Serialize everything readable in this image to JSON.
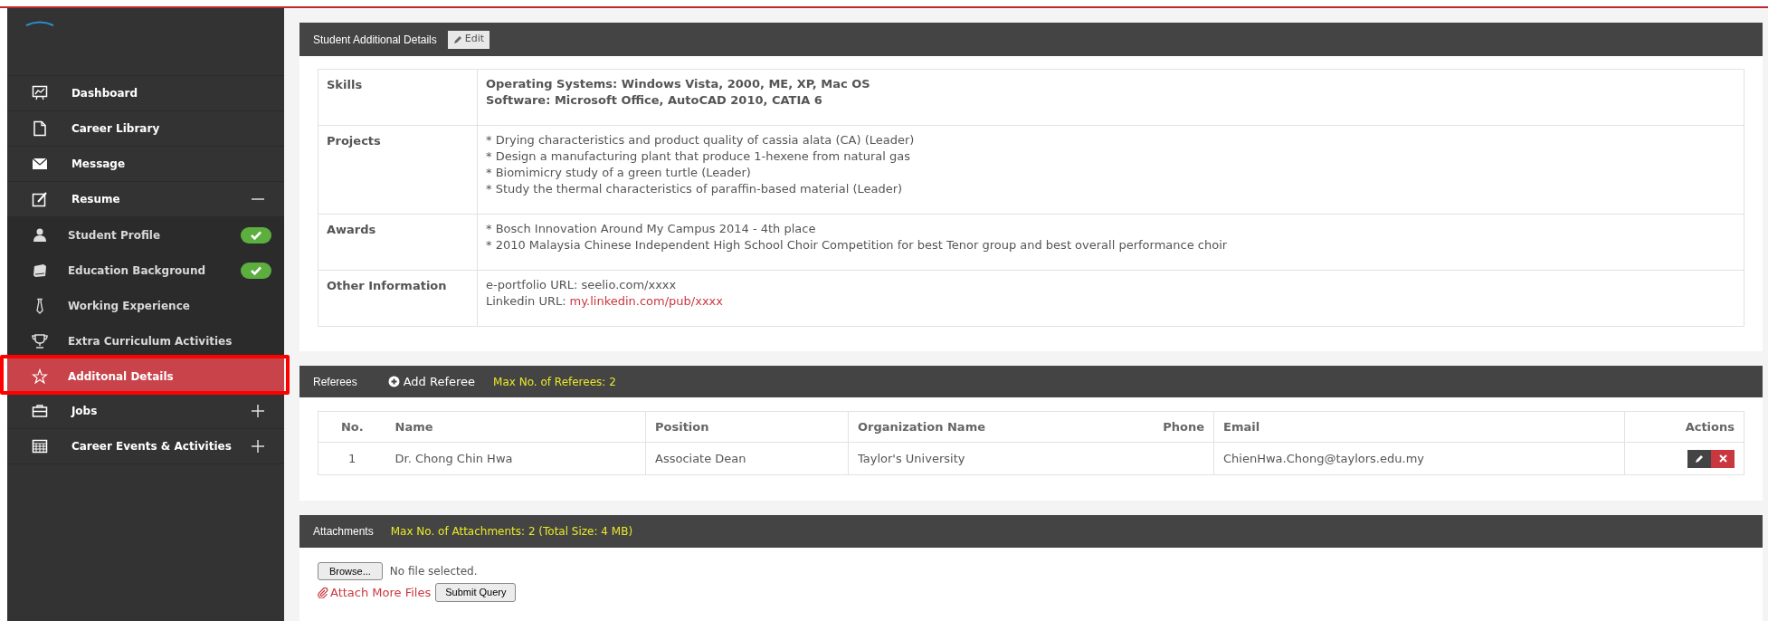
{
  "sidebar": {
    "items": [
      {
        "label": "Dashboard",
        "kind": "link",
        "selected": false
      },
      {
        "label": "Career Library",
        "kind": "link",
        "selected": false
      },
      {
        "label": "Message",
        "kind": "link",
        "selected": false
      },
      {
        "label": "Resume",
        "kind": "group",
        "selected": false,
        "expanded": true,
        "children": [
          {
            "label": "Student Profile",
            "selected": false,
            "completed": true
          },
          {
            "label": "Education Background",
            "selected": false,
            "completed": true
          },
          {
            "label": "Working Experience",
            "selected": false,
            "completed": false
          },
          {
            "label": "Extra Curriculum Activities",
            "selected": false,
            "completed": false
          },
          {
            "label": "Additonal Details",
            "selected": true,
            "completed": false
          }
        ]
      },
      {
        "label": "Jobs",
        "kind": "group",
        "selected": false,
        "expanded": false
      },
      {
        "label": "Career Events & Activities",
        "kind": "group",
        "selected": false,
        "expanded": false
      }
    ]
  },
  "details": {
    "title": "Student Additional Details",
    "edit_button": "Edit",
    "rows": [
      {
        "label": "Skills",
        "emphasis": true,
        "lines": [
          {
            "text": "Operating Systems: Windows Vista, 2000, ME, XP, Mac OS"
          },
          {
            "text": "Software: Microsoft Office, AutoCAD 2010, CATIA 6"
          }
        ]
      },
      {
        "label": "Projects",
        "emphasis": false,
        "lines": [
          {
            "text": "* Drying characteristics and product quality of cassia alata (CA) (Leader)"
          },
          {
            "text": "* Design a manufacturing plant that produce 1-hexene from natural gas"
          },
          {
            "text": "* Biomimicry study of a green turtle (Leader)"
          },
          {
            "text": "* Study the thermal characteristics of paraffin-based material (Leader)"
          }
        ]
      },
      {
        "label": "Awards",
        "emphasis": false,
        "lines": [
          {
            "text": "* Bosch Innovation Around My Campus 2014 - 4th place"
          },
          {
            "text": "* 2010 Malaysia Chinese Independent High School Choir Competition for best Tenor group and best overall performance choir"
          }
        ]
      },
      {
        "label": "Other Information",
        "emphasis": false,
        "lines": [
          {
            "text": "e-portfolio URL: seelio.com/xxxx"
          },
          {
            "text": "Linkedin URL:",
            "link": "my.linkedin.com/pub/xxxx"
          }
        ]
      }
    ]
  },
  "referees": {
    "title": "Referees",
    "add_button": "Add Referee",
    "limit": "Max No. of Referees: 2",
    "columns": [
      "No.",
      "Name",
      "Position",
      "Organization Name",
      "Phone",
      "Email",
      "Actions"
    ],
    "rows": [
      {
        "no": "1",
        "name": "Dr. Chong Chin Hwa",
        "position": "Associate Dean",
        "organization": "Taylor's University",
        "email": "ChienHwa.Chong@taylors.edu.my"
      }
    ]
  },
  "attachments": {
    "title": "Attachments",
    "limit": "Max No. of Attachments: 2 (Total Size: 4 MB)",
    "browse_button": "Browse...",
    "file_status": "No file selected.",
    "attach_link": "Attach More Files",
    "submit_button": "Submit Query"
  }
}
